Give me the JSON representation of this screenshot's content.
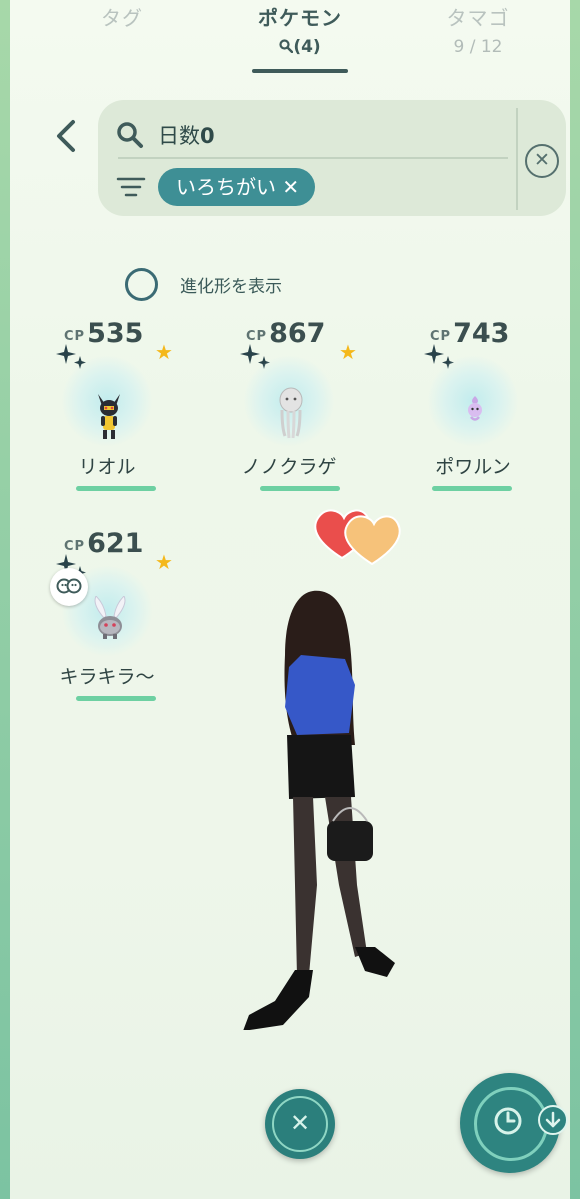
{
  "tabs": [
    {
      "label": "タグ",
      "sub": ""
    },
    {
      "label": "ポケモン",
      "sub": "(4)"
    },
    {
      "label": "タマゴ",
      "sub": "9 / 12"
    }
  ],
  "search": {
    "query_prefix": "日数",
    "query_value": "0",
    "filter_chip": "いろちがい ✕"
  },
  "show_evolutions_label": "進化形を表示",
  "pokemon": [
    {
      "cp_label": "CP",
      "cp": "535",
      "name": "リオル",
      "favorite": true
    },
    {
      "cp_label": "CP",
      "cp": "867",
      "name": "ノノクラゲ",
      "favorite": true
    },
    {
      "cp_label": "CP",
      "cp": "743",
      "name": "ポワルン",
      "favorite": false
    },
    {
      "cp_label": "CP",
      "cp": "621",
      "name": "キラキラ〜",
      "favorite": true
    }
  ],
  "colors": {
    "accent": "#3e8f95",
    "hp_bar": "#6dd0a2",
    "star": "#f4b81b"
  },
  "icons": {
    "back": "chevron-left-icon",
    "search": "search-icon",
    "filter": "filter-icon",
    "clear": "close-circle-icon",
    "close_fab": "close-icon",
    "main_fab": "clock-icon"
  }
}
